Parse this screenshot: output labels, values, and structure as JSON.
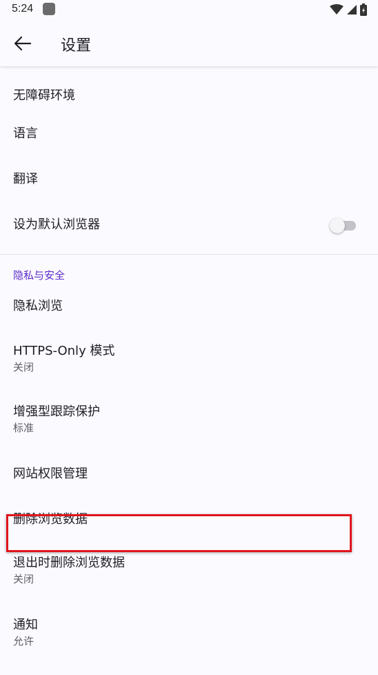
{
  "status_bar": {
    "time": "5:24",
    "icons": [
      "app-notification-icon",
      "wifi-icon",
      "cell-signal-icon",
      "battery-icon"
    ]
  },
  "toolbar": {
    "back_icon": "arrow-left-icon",
    "title": "设置"
  },
  "general_items": [
    {
      "title": "无障碍环境"
    },
    {
      "title": "语言"
    },
    {
      "title": "翻译"
    },
    {
      "title": "设为默认浏览器",
      "toggle": false
    }
  ],
  "privacy_section": {
    "header": "隐私与安全",
    "items": [
      {
        "title": "隐私浏览"
      },
      {
        "title": "HTTPS-Only 模式",
        "subtitle": "关闭"
      },
      {
        "title": "增强型跟踪保护",
        "subtitle": "标准"
      },
      {
        "title": "网站权限管理"
      },
      {
        "title": "删除浏览数据",
        "highlighted": true
      },
      {
        "title": "退出时删除浏览数据",
        "subtitle": "关闭"
      },
      {
        "title": "通知",
        "subtitle": "允许"
      }
    ]
  },
  "colors": {
    "accent": "#592acb",
    "highlight_border": "#e0141c",
    "background": "#fbfafe"
  }
}
